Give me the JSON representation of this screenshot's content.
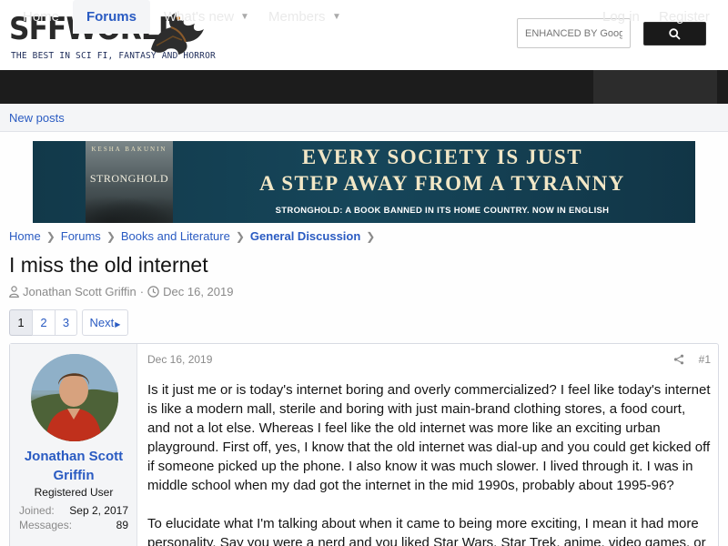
{
  "site": {
    "logo_text": "SFFWORLD",
    "tagline": "THE BEST IN SCI FI, FANTASY AND HORROR"
  },
  "search": {
    "placeholder": "ENHANCED BY Google",
    "button_icon": "search-icon"
  },
  "nav": {
    "home": "Home",
    "forums": "Forums",
    "whats_new": "What's new",
    "members": "Members",
    "login": "Log in",
    "register": "Register",
    "dropdown_icon": "caret-down-icon"
  },
  "subnav": {
    "new_posts": "New posts"
  },
  "banner": {
    "book_author": "KESHA BAKUNIN",
    "book_title": "STRONGHOLD",
    "line1": "EVERY SOCIETY IS JUST",
    "line2": "A STEP AWAY FROM A TYRANNY",
    "line3": "STRONGHOLD: A BOOK BANNED IN ITS HOME COUNTRY. NOW IN ENGLISH",
    "bg_color": "#16465a",
    "text_color": "#f2e7c6"
  },
  "breadcrumb": [
    "Home",
    "Forums",
    "Books and Literature",
    "General Discussion"
  ],
  "thread": {
    "title": "I miss the old internet",
    "author": "Jonathan Scott Griffin",
    "separator": "·",
    "date": "Dec 16, 2019"
  },
  "pagination": {
    "pages": [
      "1",
      "2",
      "3"
    ],
    "current": "1",
    "next": "Next"
  },
  "post": {
    "date": "Dec 16, 2019",
    "number": "#1",
    "user": {
      "name": "Jonathan Scott Griffin",
      "title": "Registered User",
      "joined_label": "Joined:",
      "joined_value": "Sep 2, 2017",
      "messages_label": "Messages:",
      "messages_value": "89"
    },
    "paragraphs": [
      "Is it just me or is today's internet boring and overly commercialized? I feel like today's internet is like a modern mall, sterile and boring with just main-brand clothing stores, a food court, and not a lot else. Whereas I feel like the old internet was more like an exciting urban playground. First off, yes, I know that the old internet was dial-up and you could get kicked off if someone picked up the phone. I also know it was much slower. I lived through it. I was in middle school when my dad got the internet in the mid 1990s, probably about 1995-96?",
      "To elucidate what I'm talking about when it came to being more exciting, I mean it had more personality. Say you were a nerd and you liked Star Wars, Star Trek, anime, video games, or"
    ]
  },
  "colors": {
    "link": "#2a5bc2",
    "navbar": "#1c1c1c",
    "muted": "#8a8a8a"
  }
}
